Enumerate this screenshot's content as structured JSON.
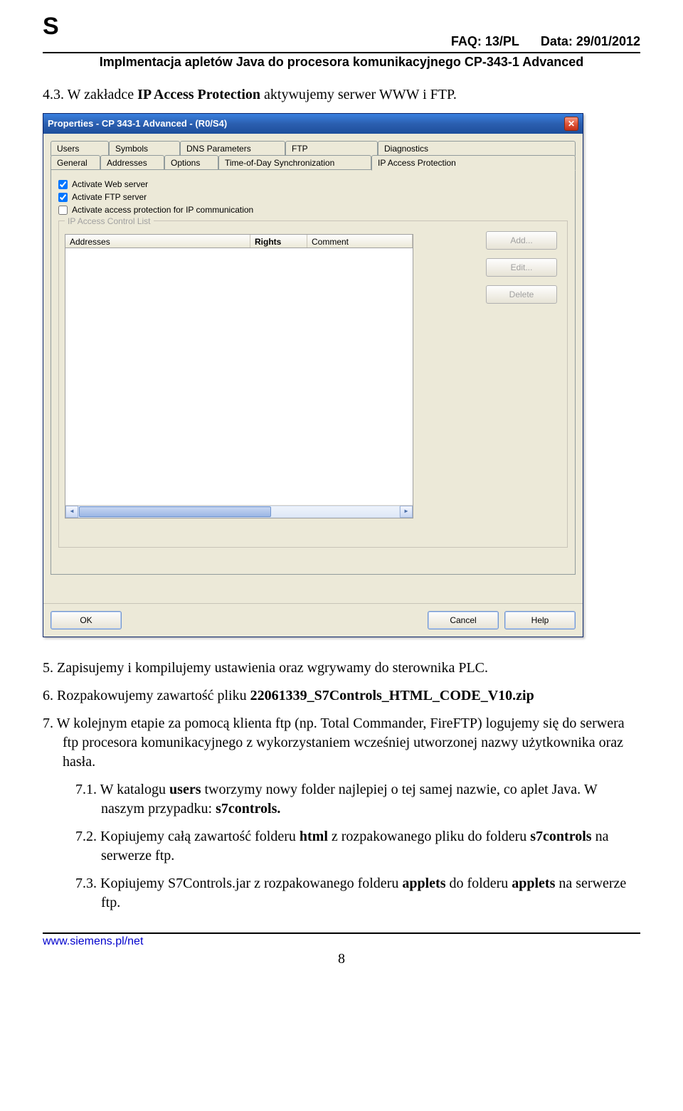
{
  "header": {
    "s_logo": "S",
    "faq": "FAQ: 13/PL",
    "date": "Data: 29/01/2012",
    "subtitle": "Implmentacja apletów Java do procesora komunikacyjnego CP-343-1 Advanced"
  },
  "dialog": {
    "title": "Properties - CP 343-1 Advanced - (R0/S4)",
    "tabs_top": [
      "Users",
      "Symbols",
      "DNS Parameters",
      "FTP",
      "Diagnostics"
    ],
    "tabs_bottom": [
      "General",
      "Addresses",
      "Options",
      "Time-of-Day Synchronization",
      "IP Access Protection"
    ],
    "active_tab": "IP Access Protection",
    "chk1": "Activate Web server",
    "chk2": "Activate FTP server",
    "chk3": "Activate access protection for IP communication",
    "group_label": "IP Access Control List",
    "col_addr": "Addresses",
    "col_rights": "Rights",
    "col_comment": "Comment",
    "btn_add": "Add...",
    "btn_edit": "Edit...",
    "btn_delete": "Delete",
    "btn_ok": "OK",
    "btn_cancel": "Cancel",
    "btn_help": "Help"
  },
  "sections": {
    "p43_num": "4.3. ",
    "p43_a": "W zakładce ",
    "p43_b": "IP Access Protection",
    "p43_c": " aktywujemy serwer WWW i FTP.",
    "p5": "5. Zapisujemy i kompilujemy ustawienia oraz wgrywamy do sterownika PLC.",
    "p6_a": "6. Rozpakowujemy zawartość pliku ",
    "p6_b": "22061339_S7Controls_HTML_CODE_V10.zip",
    "p7": "7. W kolejnym etapie za pomocą klienta ftp (np. Total Commander, FireFTP) logujemy się do serwera ftp procesora komunikacyjnego z wykorzystaniem wcześniej utworzonej nazwy użytkownika oraz hasła.",
    "p71_a": "7.1. W katalogu ",
    "p71_b": "users",
    "p71_c": " tworzymy nowy folder najlepiej o tej samej nazwie, co aplet Java. W naszym przypadku: ",
    "p71_d": "s7controls.",
    "p72_a": "7.2. Kopiujemy całą zawartość folderu ",
    "p72_b": "html",
    "p72_c": " z rozpakowanego pliku do folderu ",
    "p72_d": "s7controls",
    "p72_e": " na serwerze ftp.",
    "p73_a": "7.3. Kopiujemy S7Controls.jar z rozpakowanego folderu ",
    "p73_b": "applets",
    "p73_c": " do folderu ",
    "p73_d": "applets",
    "p73_e": " na serwerze ftp."
  },
  "footer": {
    "url": "www.siemens.pl/net",
    "page": "8"
  }
}
